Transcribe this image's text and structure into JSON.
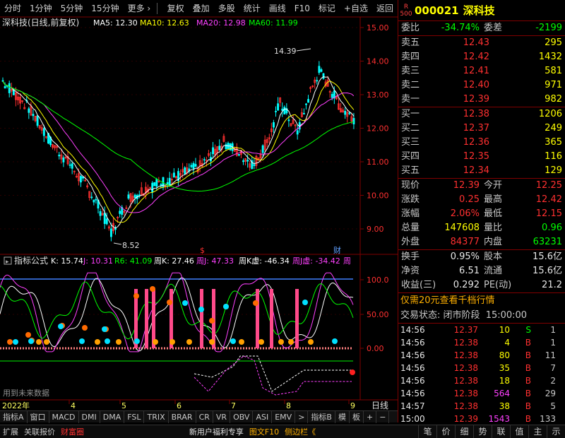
{
  "toolbar": {
    "left_items": [
      "分时",
      "1分钟",
      "5分钟",
      "15分钟",
      "更多 ›"
    ],
    "right_items": [
      "复权",
      "叠加",
      "多股",
      "统计",
      "画线",
      "F10",
      "标记",
      "+自选",
      "返回"
    ]
  },
  "chart": {
    "title": "深科技(日线,前复权)",
    "ma_labels": [
      {
        "text": "MA5: 12.30",
        "color": "#ffffff"
      },
      {
        "text": "MA10: 12.63",
        "color": "#ffff00"
      },
      {
        "text": "MA20: 12.98",
        "color": "#ff40ff"
      },
      {
        "text": "MA60: 11.99",
        "color": "#00ff00"
      }
    ],
    "price_ticks": [
      "15.00",
      "14.00",
      "13.00",
      "12.00",
      "11.00",
      "10.00",
      "9.00"
    ],
    "high_marker": "14.39",
    "low_marker": "8.52",
    "event_marker_s": "$",
    "event_marker_cai": "财"
  },
  "indicator": {
    "title": "指标公式",
    "labels": [
      {
        "text": "K: 15.74",
        "color": "#ffffff"
      },
      {
        "text": "J: 10.31",
        "color": "#ff40ff"
      },
      {
        "text": "R6: 41.09",
        "color": "#00ff00"
      },
      {
        "text": "周K: 27.46",
        "color": "#ffffff"
      },
      {
        "text": "周J: 47.33",
        "color": "#ff40ff"
      },
      {
        "text": "周K虚: -46.34",
        "color": "#ffffff"
      },
      {
        "text": "周J虚: -34.42",
        "color": "#ff40ff"
      },
      {
        "text": "周",
        "color": "#ff40ff"
      }
    ],
    "ticks": [
      "100.0",
      "50.00",
      "0.00"
    ],
    "note": "用到未来数据"
  },
  "time_axis": {
    "year": "2022年",
    "months": [
      "4",
      "5",
      "6",
      "7",
      "8",
      "9"
    ],
    "period": "日线"
  },
  "bottom_tabs": [
    "指标A",
    "窗口",
    "MACD",
    "DMI",
    "DMA",
    "FSL",
    "TRIX",
    "BRAR",
    "CR",
    "VR",
    "OBV",
    "ASI",
    "EMV",
    ">",
    "指标B",
    "模",
    "板",
    "+",
    "−"
  ],
  "status_bar": {
    "left": [
      "扩展",
      "关联报价",
      "财富圈"
    ],
    "middle": [
      "新用户福利专享",
      "图文F10",
      "侧边栏《"
    ],
    "icons": [
      "笔",
      "价",
      "细",
      "势",
      "联",
      "值",
      "主",
      "示"
    ]
  },
  "quote": {
    "code": "000021",
    "name": "深科技",
    "badge_top": "R",
    "badge_bottom": "500",
    "weibi_label": "委比",
    "weibi_value": "-34.74%",
    "weicha_label": "委差",
    "weicha_value": "-2199",
    "asks": [
      {
        "label": "卖五",
        "price": "12.43",
        "vol": "295"
      },
      {
        "label": "卖四",
        "price": "12.42",
        "vol": "1432"
      },
      {
        "label": "卖三",
        "price": "12.41",
        "vol": "581"
      },
      {
        "label": "卖二",
        "price": "12.40",
        "vol": "971"
      },
      {
        "label": "卖一",
        "price": "12.39",
        "vol": "982"
      }
    ],
    "bids": [
      {
        "label": "买一",
        "price": "12.38",
        "vol": "1206"
      },
      {
        "label": "买二",
        "price": "12.37",
        "vol": "249"
      },
      {
        "label": "买三",
        "price": "12.36",
        "vol": "365"
      },
      {
        "label": "买四",
        "price": "12.35",
        "vol": "116"
      },
      {
        "label": "买五",
        "price": "12.34",
        "vol": "129"
      }
    ],
    "stats1": [
      {
        "l1": "现价",
        "v1": "12.39",
        "c1": "red",
        "l2": "今开",
        "v2": "12.25",
        "c2": "red"
      },
      {
        "l1": "涨跌",
        "v1": "0.25",
        "c1": "red",
        "l2": "最高",
        "v2": "12.42",
        "c2": "red"
      },
      {
        "l1": "涨幅",
        "v1": "2.06%",
        "c1": "red",
        "l2": "最低",
        "v2": "12.15",
        "c2": "red"
      },
      {
        "l1": "总量",
        "v1": "147608",
        "c1": "yellow",
        "l2": "量比",
        "v2": "0.96",
        "c2": "green"
      },
      {
        "l1": "外盘",
        "v1": "84377",
        "c1": "red",
        "l2": "内盘",
        "v2": "63231",
        "c2": "green"
      }
    ],
    "stats2": [
      {
        "l1": "换手",
        "v1": "0.95%",
        "c1": "white",
        "l2": "股本",
        "v2": "15.6亿",
        "c2": "white"
      },
      {
        "l1": "净资",
        "v1": "6.51",
        "c1": "white",
        "l2": "流通",
        "v2": "15.6亿",
        "c2": "white"
      },
      {
        "l1": "收益(三)",
        "v1": "0.292",
        "c1": "white",
        "l2": "PE(动)",
        "v2": "21.2",
        "c2": "white"
      }
    ],
    "promo": "仅需20元查看千档行情",
    "trade_status_label": "交易状态:",
    "trade_status_value": "闭市阶段",
    "trade_status_time": "15:00:00",
    "ticks": [
      {
        "time": "14:56",
        "price": "12.37",
        "vol": "10",
        "bs": "S",
        "n": "1"
      },
      {
        "time": "14:56",
        "price": "12.38",
        "vol": "4",
        "bs": "B",
        "n": "1"
      },
      {
        "time": "14:56",
        "price": "12.38",
        "vol": "80",
        "bs": "B",
        "n": "11"
      },
      {
        "time": "14:56",
        "price": "12.38",
        "vol": "35",
        "bs": "B",
        "n": "7"
      },
      {
        "time": "14:56",
        "price": "12.38",
        "vol": "18",
        "bs": "B",
        "n": "2"
      },
      {
        "time": "14:56",
        "price": "12.38",
        "vol": "564",
        "bs": "B",
        "n": "29"
      },
      {
        "time": "14:57",
        "price": "12.38",
        "vol": "38",
        "bs": "B",
        "n": "5"
      },
      {
        "time": "15:00",
        "price": "12.39",
        "vol": "1543",
        "bs": "B",
        "n": "133"
      }
    ]
  },
  "colors": {
    "up": "#ff3030",
    "down": "#00ffff",
    "ma5": "#ffffff",
    "ma10": "#ffff00",
    "ma20": "#ff40ff",
    "ma60": "#00ff00"
  }
}
